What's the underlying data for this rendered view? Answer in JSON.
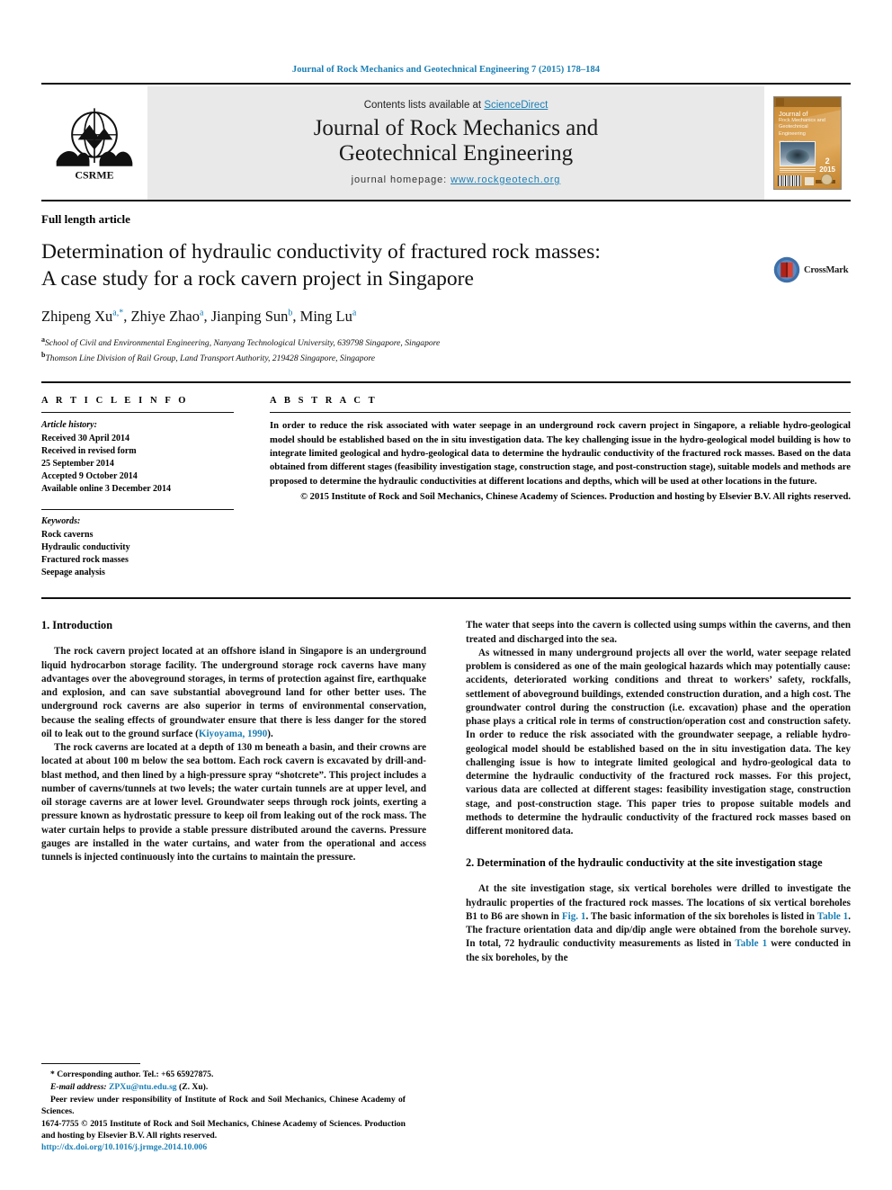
{
  "running_head": "Journal of Rock Mechanics and Geotechnical Engineering 7 (2015) 178–184",
  "masthead": {
    "logo_text": "CSRME",
    "contents_prefix": "Contents lists available at ",
    "sciencedirect": "ScienceDirect",
    "journal_title_line1": "Journal of Rock Mechanics and",
    "journal_title_line2": "Geotechnical Engineering",
    "homepage_label": "journal homepage: ",
    "homepage_url": "www.rockgeotech.org",
    "cover": {
      "line1": "Journal of",
      "line2": "Rock Mechanics and",
      "line3": "Geotechnical",
      "line4": "Engineering",
      "small": "ISSN 1674-7755",
      "volume": "2",
      "year": "2015"
    }
  },
  "article": {
    "type": "Full length article",
    "title_line1": "Determination of hydraulic conductivity of fractured rock masses:",
    "title_line2": "A case study for a rock cavern project in Singapore",
    "authors_html": "Zhipeng Xu<sup>a,*</sup>, Zhiye Zhao<sup>a</sup>, Jianping Sun<sup>b</sup>, Ming Lu<sup>a</sup>",
    "affiliation_a": "School of Civil and Environmental Engineering, Nanyang Technological University, 639798 Singapore, Singapore",
    "affiliation_b": "Thomson Line Division of Rail Group, Land Transport Authority, 219428 Singapore, Singapore",
    "crossmark_label": "CrossMark"
  },
  "info": {
    "heading": "A R T I C L E   I N F O",
    "history_label": "Article history:",
    "history": [
      "Received 30 April 2014",
      "Received in revised form",
      "25 September 2014",
      "Accepted 9 October 2014",
      "Available online 3 December 2014"
    ],
    "keywords_label": "Keywords:",
    "keywords": [
      "Rock caverns",
      "Hydraulic conductivity",
      "Fractured rock masses",
      "Seepage analysis"
    ]
  },
  "abstract": {
    "heading": "A B S T R A C T",
    "text": "In order to reduce the risk associated with water seepage in an underground rock cavern project in Singapore, a reliable hydro-geological model should be established based on the in situ investigation data. The key challenging issue in the hydro-geological model building is how to integrate limited geological and hydro-geological data to determine the hydraulic conductivity of the fractured rock masses. Based on the data obtained from different stages (feasibility investigation stage, construction stage, and post-construction stage), suitable models and methods are proposed to determine the hydraulic conductivities at different locations and depths, which will be used at other locations in the future.",
    "copyright": "© 2015 Institute of Rock and Soil Mechanics, Chinese Academy of Sciences. Production and hosting by Elsevier B.V. All rights reserved."
  },
  "body": {
    "left": {
      "heading_1": "1. Introduction",
      "para_1_pre": "The rock cavern project located at an offshore island in Singapore is an underground liquid hydrocarbon storage facility. The underground storage rock caverns have many advantages over the aboveground storages, in terms of protection against fire, earthquake and explosion, and can save substantial aboveground land for other better uses. The underground rock caverns are also superior in terms of environmental conservation, because the sealing effects of groundwater ensure that there is less danger for the stored oil to leak out to the ground surface (",
      "para_1_ref": "Kiyoyama, 1990",
      "para_1_post": ").",
      "para_2": "The rock caverns are located at a depth of 130 m beneath a basin, and their crowns are located at about 100 m below the sea bottom. Each rock cavern is excavated by drill-and-blast method, and then lined by a high-pressure spray “shotcrete”. This project includes a number of caverns/tunnels at two levels; the water curtain tunnels are at upper level, and oil storage caverns are at lower level. Groundwater seeps through rock joints, exerting a pressure known as hydrostatic pressure to keep oil from leaking out of the rock mass. The water curtain helps to provide a stable pressure distributed around the caverns. Pressure gauges are installed in the water curtains, and water from the operational and access tunnels is injected continuously into the curtains to maintain the pressure."
    },
    "right": {
      "para_1": "The water that seeps into the cavern is collected using sumps within the caverns, and then treated and discharged into the sea.",
      "para_2": "As witnessed in many underground projects all over the world, water seepage related problem is considered as one of the main geological hazards which may potentially cause: accidents, deteriorated working conditions and threat to workers’ safety, rockfalls, settlement of aboveground buildings, extended construction duration, and a high cost. The groundwater control during the construction (i.e. excavation) phase and the operation phase plays a critical role in terms of construction/operation cost and construction safety. In order to reduce the risk associated with the groundwater seepage, a reliable hydro-geological model should be established based on the in situ investigation data. The key challenging issue is how to integrate limited geological and hydro-geological data to determine the hydraulic conductivity of the fractured rock masses. For this project, various data are collected at different stages: feasibility investigation stage, construction stage, and post-construction stage. This paper tries to propose suitable models and methods to determine the hydraulic conductivity of the fractured rock masses based on different monitored data.",
      "heading_2": "2. Determination of the hydraulic conductivity at the site investigation stage",
      "para_3_a": "At the site investigation stage, six vertical boreholes were drilled to investigate the hydraulic properties of the fractured rock masses. The locations of six vertical boreholes B1 to B6 are shown in ",
      "para_3_ref1": "Fig. 1",
      "para_3_b": ". The basic information of the six boreholes is listed in ",
      "para_3_ref2": "Table 1",
      "para_3_c": ". The fracture orientation data and dip/dip angle were obtained from the borehole survey. In total, 72 hydraulic conductivity measurements as listed in ",
      "para_3_ref3": "Table 1",
      "para_3_d": " were conducted in the six boreholes, by the"
    }
  },
  "footnotes": {
    "corresponding": "* Corresponding author. Tel.: +65 65927875.",
    "email_label": "E-mail address: ",
    "email": "ZPXu@ntu.edu.sg",
    "email_suffix": " (Z. Xu).",
    "peer_review": "Peer review under responsibility of Institute of Rock and Soil Mechanics, Chinese Academy of Sciences.",
    "issn_line": "1674-7755 © 2015 Institute of Rock and Soil Mechanics, Chinese Academy of Sciences. Production and hosting by Elsevier B.V. All rights reserved.",
    "doi": "http://dx.doi.org/10.1016/j.jrmge.2014.10.006"
  },
  "colors": {
    "link": "#1b7fb5",
    "mast_bg": "#e9e9e9",
    "cover_bg": "#d08f38"
  }
}
